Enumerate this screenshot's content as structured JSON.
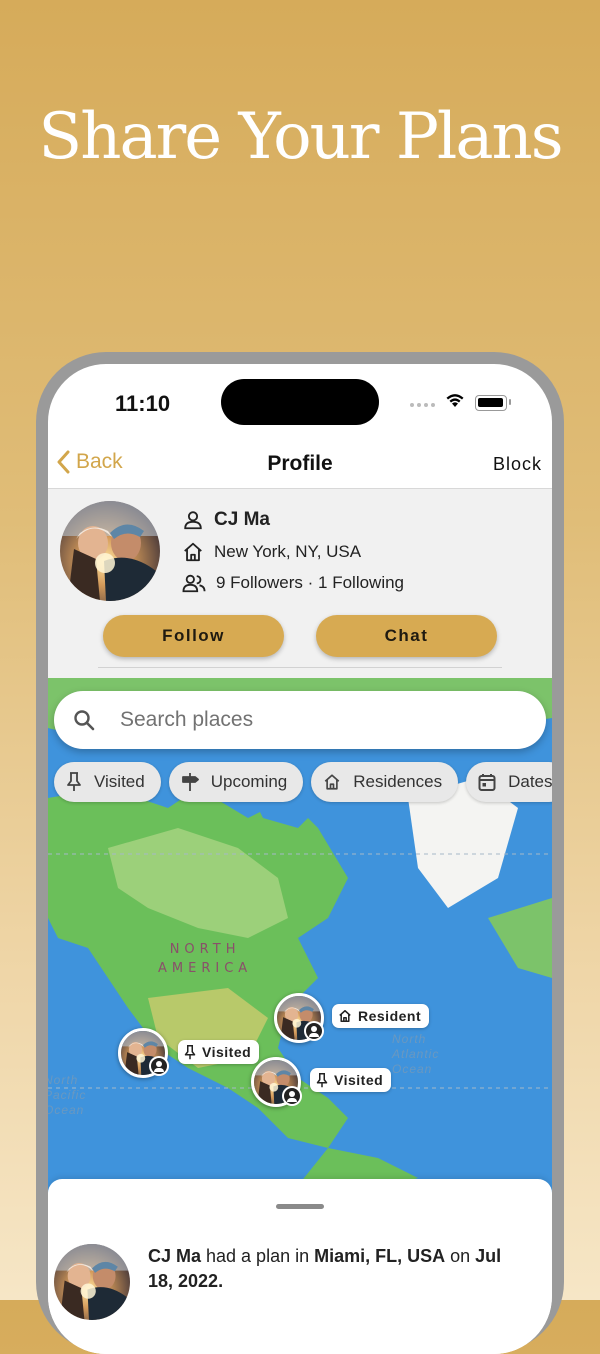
{
  "headline": "Share Your Plans",
  "status_bar": {
    "time": "11:10"
  },
  "nav": {
    "back_label": "Back",
    "title": "Profile",
    "block_label": "Block"
  },
  "profile": {
    "name": "CJ Ma",
    "location": "New York, NY, USA",
    "follow_stats": "9 Followers · 1 Following",
    "follow_button": "Follow",
    "chat_button": "Chat"
  },
  "search": {
    "placeholder": "Search places"
  },
  "filters": [
    {
      "label": "Visited",
      "icon": "pin-icon"
    },
    {
      "label": "Upcoming",
      "icon": "signpost-icon"
    },
    {
      "label": "Residences",
      "icon": "home-icon"
    },
    {
      "label": "Dates",
      "icon": "calendar-icon"
    }
  ],
  "map": {
    "continent_label_1": "NORTH",
    "continent_label_2": "AMERICA",
    "ocean_1_line_1": "North",
    "ocean_1_line_2": "Atlantic",
    "ocean_1_line_3": "Ocean",
    "ocean_2_line_1": "North",
    "ocean_2_line_2": "Pacific",
    "ocean_2_line_3": "Ocean",
    "markers": [
      {
        "tag": "Resident",
        "icon": "home-icon"
      },
      {
        "tag": "Visited",
        "icon": "pin-icon"
      },
      {
        "tag": "Visited",
        "icon": "pin-icon"
      }
    ]
  },
  "activity": {
    "user": "CJ Ma",
    "text_1": " had a plan in ",
    "place": "Miami, FL, USA",
    "text_2": " on ",
    "date": "Jul 18, 2022."
  },
  "colors": {
    "accent": "#d7aa52",
    "back_link": "#d2a64b",
    "ocean": "#3a8fd8",
    "land": "#6bbf5a"
  }
}
